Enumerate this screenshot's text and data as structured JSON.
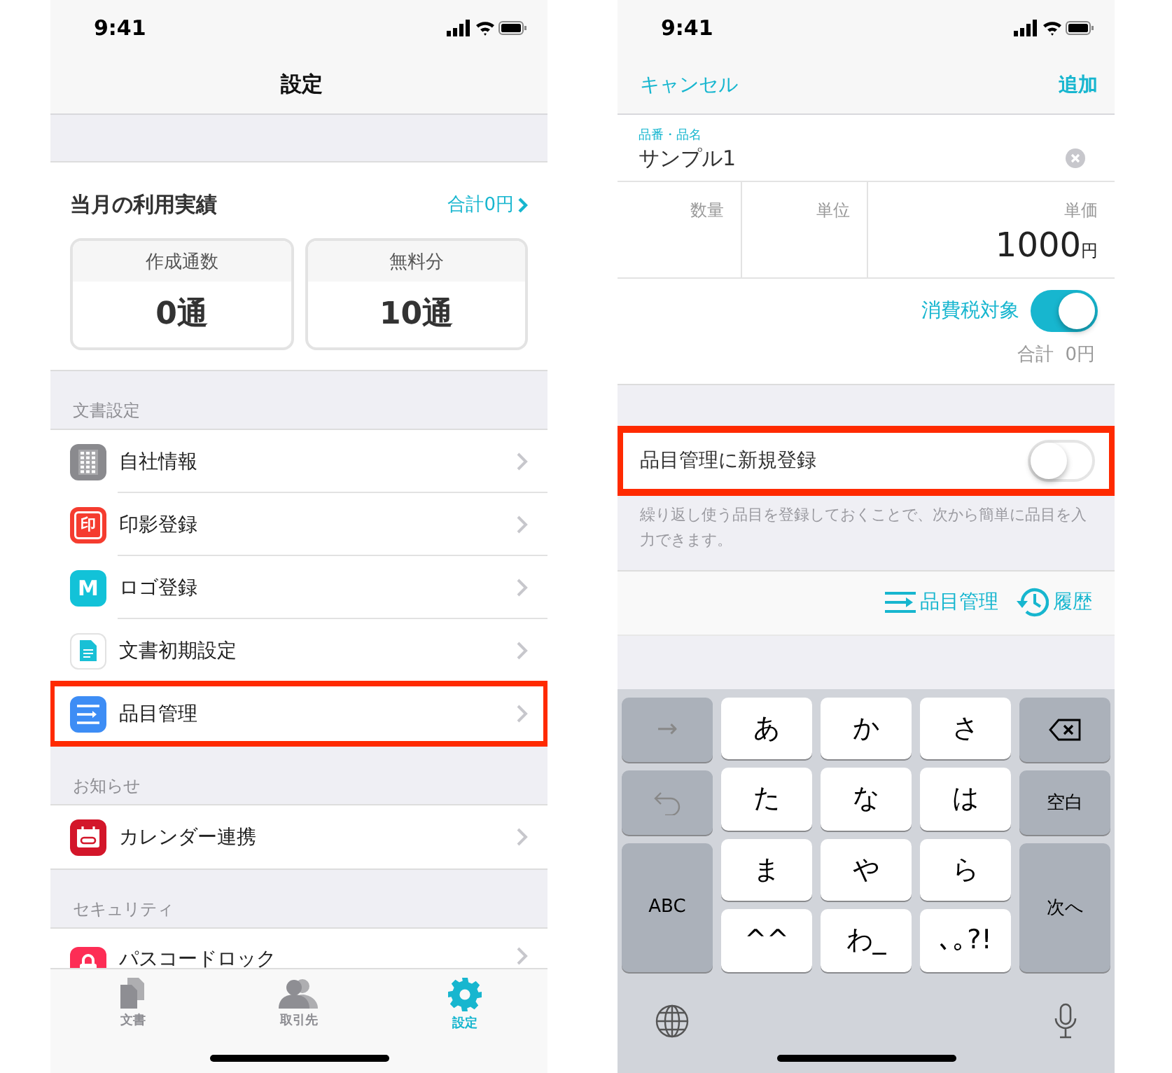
{
  "settings_screen": {
    "status_time": "9:41",
    "title": "設定",
    "usage": {
      "title": "当月の利用実績",
      "total_link": "合計0円",
      "stats": [
        {
          "label": "作成通数",
          "value": "0通"
        },
        {
          "label": "無料分",
          "value": "10通"
        }
      ]
    },
    "sections": [
      {
        "header": "文書設定",
        "items": [
          {
            "label": "自社情報",
            "highlighted": false
          },
          {
            "label": "印影登録",
            "icon_text": "印",
            "highlighted": false
          },
          {
            "label": "ロゴ登録",
            "icon_text": "M",
            "highlighted": false
          },
          {
            "label": "文書初期設定",
            "highlighted": false
          },
          {
            "label": "品目管理",
            "highlighted": true
          }
        ]
      },
      {
        "header": "お知らせ",
        "items": [
          {
            "label": "カレンダー連携",
            "highlighted": false
          }
        ]
      },
      {
        "header": "セキュリティ",
        "items": [
          {
            "label": "パスコードロック",
            "highlighted": false
          }
        ]
      }
    ],
    "tab_bar": [
      {
        "label": "文書",
        "selected": false
      },
      {
        "label": "取引先",
        "selected": false
      },
      {
        "label": "設定",
        "selected": true
      }
    ]
  },
  "item_screen": {
    "status_time": "9:41",
    "cancel": "キャンセル",
    "add": "追加",
    "name_field": {
      "label": "品番・品名",
      "value": "サンプル1"
    },
    "quantity": {
      "label": "数量"
    },
    "unit": {
      "label": "単位"
    },
    "price": {
      "label": "単価",
      "value": "1000",
      "currency": "円"
    },
    "tax": {
      "label": "消費税対象",
      "on": true
    },
    "total": "合計  0円",
    "register": {
      "label": "品目管理に新規登録",
      "on": false,
      "highlighted": true
    },
    "note": "繰り返し使う品目を登録しておくことで、次から簡単に品目を入力できます。",
    "actions": [
      {
        "label": "品目管理"
      },
      {
        "label": "履歴"
      }
    ],
    "keyboard": {
      "left": [
        {
          "kind": "text",
          "label": "→"
        },
        {
          "kind": "undo"
        },
        {
          "kind": "text",
          "label": "ABC"
        }
      ],
      "center": [
        "あ",
        "か",
        "さ",
        "た",
        "な",
        "は",
        "ま",
        "や",
        "ら",
        "^^",
        "わ_",
        "､｡?!"
      ],
      "right": [
        {
          "kind": "delete"
        },
        {
          "kind": "text",
          "label": "空白"
        },
        {
          "kind": "text",
          "label": "次へ"
        }
      ]
    }
  }
}
